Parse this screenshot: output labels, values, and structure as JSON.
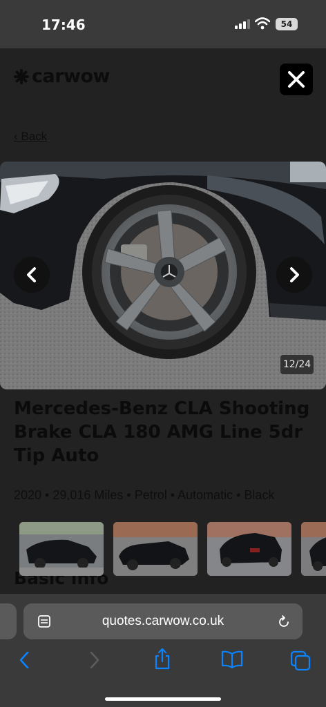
{
  "status": {
    "time": "17:46",
    "battery": "54"
  },
  "site": {
    "logo": "carwow",
    "back_label": "Back"
  },
  "gallery": {
    "counter": "12/24"
  },
  "listing": {
    "title": "Mercedes-Benz CLA Shooting Brake CLA 180 AMG Line 5dr Tip Auto",
    "specs": "2020 • 29,016 Miles • Petrol • Automatic • Black",
    "section_heading": "Basic info"
  },
  "browser": {
    "url": "quotes.carwow.co.uk"
  },
  "icons": {
    "close": "close-icon",
    "prev": "chevron-left-icon",
    "next": "chevron-right-icon",
    "reader": "reader-icon",
    "reload": "reload-icon",
    "back": "back-arrow-icon",
    "forward": "forward-arrow-icon",
    "share": "share-icon",
    "bookmarks": "bookmarks-icon",
    "tabs": "tabs-icon"
  },
  "colors": {
    "accent": "#0a84ff",
    "overlay": "#222222"
  }
}
